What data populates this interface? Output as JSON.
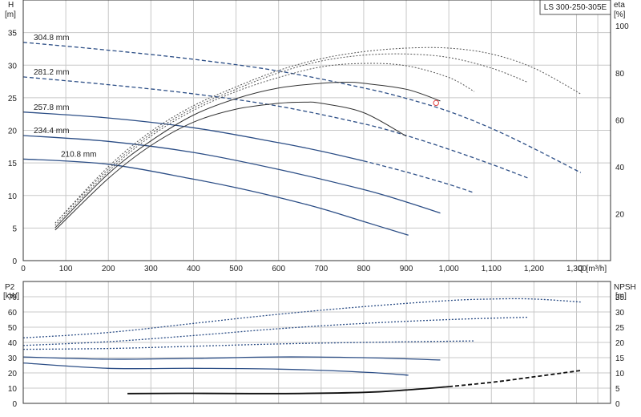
{
  "model_label": "LS 300-250-305E",
  "top_chart": {
    "y_label_name": "H",
    "y_label_unit": "[m]",
    "y2_label_name": "eta",
    "y2_label_unit": "[%]",
    "x_label": "Q [m³/h]",
    "x_ticks": [
      "0",
      "100",
      "200",
      "300",
      "400",
      "500",
      "600",
      "700",
      "800",
      "900",
      "1,000",
      "1,100",
      "1,200",
      "1,300"
    ],
    "y_ticks": [
      "0",
      "5",
      "10",
      "15",
      "20",
      "25",
      "30",
      "35"
    ],
    "y2_ticks": [
      "20",
      "40",
      "60",
      "80",
      "100"
    ]
  },
  "bottom_chart": {
    "y_label_name": "P2",
    "y_label_unit": "[kW]",
    "y2_label_name": "NPSH",
    "y2_label_unit": "[m]",
    "y_ticks": [
      "0",
      "10",
      "20",
      "30",
      "40",
      "50",
      "60",
      "70"
    ],
    "y2_ticks": [
      "0",
      "5",
      "10",
      "15",
      "20",
      "25",
      "30",
      "35"
    ]
  },
  "chart_data": [
    {
      "type": "line",
      "title": "",
      "xlabel": "Q [m³/h]",
      "ylabel": "H [m]",
      "y2label": "eta [%]",
      "xlim": [
        0,
        1380
      ],
      "ylim": [
        0,
        40
      ],
      "y2lim": [
        0,
        111
      ],
      "grid": true,
      "series": [
        {
          "name": "304.8 mm",
          "kind": "head",
          "style": "dashed",
          "color": "#2c4e86",
          "x": [
            0,
            200,
            400,
            600,
            800,
            900,
            1000,
            1100,
            1200,
            1310
          ],
          "y": [
            33.5,
            32.3,
            30.9,
            29.1,
            26.5,
            24.9,
            22.9,
            20.3,
            17.2,
            13.5
          ]
        },
        {
          "name": "281.2 mm",
          "kind": "head",
          "style": "dashed",
          "color": "#2c4e86",
          "x": [
            0,
            200,
            400,
            600,
            800,
            900,
            1000,
            1100,
            1185
          ],
          "y": [
            28.2,
            27.0,
            25.6,
            23.7,
            21.0,
            19.2,
            17.1,
            14.8,
            12.7
          ]
        },
        {
          "name": "257.8 mm",
          "kind": "head",
          "style": "solid-dashed",
          "color": "#2c4e86",
          "x": [
            0,
            200,
            400,
            600,
            700,
            800,
            900,
            1000,
            1060
          ],
          "y": [
            22.8,
            21.9,
            20.4,
            18.1,
            16.8,
            15.3,
            13.6,
            11.7,
            10.4
          ]
        },
        {
          "name": "234.4 mm",
          "kind": "head",
          "style": "solid",
          "color": "#2c4e86",
          "x": [
            0,
            200,
            400,
            600,
            800,
            900,
            980
          ],
          "y": [
            19.2,
            18.3,
            16.6,
            14.0,
            10.9,
            9.0,
            7.3
          ]
        },
        {
          "name": "210.8 mm",
          "kind": "head",
          "style": "solid",
          "color": "#2c4e86",
          "x": [
            0,
            200,
            400,
            500,
            600,
            700,
            800,
            905
          ],
          "y": [
            15.6,
            14.8,
            12.5,
            11.2,
            9.7,
            8.0,
            6.0,
            3.9
          ]
        },
        {
          "name": "eta 304.8 mm",
          "kind": "eta",
          "style": "dotted",
          "color": "#555555",
          "x": [
            75,
            200,
            300,
            400,
            500,
            600,
            700,
            800,
            900,
            1000,
            1100,
            1200,
            1310
          ],
          "y": [
            16,
            40,
            55,
            66,
            74,
            81,
            86,
            89,
            90.5,
            90.5,
            88,
            82,
            71
          ]
        },
        {
          "name": "eta 281.2 mm",
          "kind": "eta",
          "style": "dotted",
          "color": "#555555",
          "x": [
            75,
            200,
            300,
            400,
            500,
            600,
            700,
            800,
            900,
            1000,
            1100,
            1185
          ],
          "y": [
            16,
            39,
            54,
            65,
            73,
            80,
            85,
            87.5,
            88,
            86.5,
            82,
            76
          ]
        },
        {
          "name": "eta 257.8 mm",
          "kind": "eta",
          "style": "dotted",
          "color": "#555555",
          "x": [
            75,
            200,
            300,
            400,
            500,
            600,
            700,
            800,
            900,
            1000,
            1060
          ],
          "y": [
            15,
            38,
            53,
            64,
            72,
            78,
            82.5,
            84,
            83,
            78,
            72
          ]
        },
        {
          "name": "eta 234.4 mm",
          "kind": "eta",
          "style": "solid",
          "color": "#333333",
          "x": [
            75,
            200,
            300,
            400,
            500,
            600,
            700,
            760,
            800,
            900,
            980
          ],
          "y": [
            14,
            37,
            51,
            62,
            69,
            73.5,
            75.5,
            76,
            75.5,
            73,
            68
          ]
        },
        {
          "name": "eta 210.8 mm",
          "kind": "eta",
          "style": "solid",
          "color": "#333333",
          "x": [
            75,
            200,
            300,
            400,
            500,
            600,
            660,
            700,
            800,
            900
          ],
          "y": [
            13,
            35,
            49,
            59,
            64.5,
            67,
            67.5,
            67,
            63,
            53
          ]
        }
      ],
      "duty_point": {
        "x": 970,
        "y": 24.2,
        "color": "#e04040"
      }
    },
    {
      "type": "line",
      "title": "",
      "xlabel": "",
      "ylabel": "P2 [kW]",
      "y2label": "NPSH [m]",
      "xlim": [
        0,
        1380
      ],
      "ylim": [
        0,
        80
      ],
      "y2lim": [
        0,
        40
      ],
      "grid": true,
      "series": [
        {
          "name": "P2 304.8 mm",
          "kind": "power",
          "style": "dotted",
          "color": "#2c4e86",
          "x": [
            0,
            200,
            400,
            600,
            800,
            1000,
            1100,
            1200,
            1310
          ],
          "y": [
            43,
            46.5,
            52.5,
            58.5,
            63.5,
            67.5,
            68.5,
            68.5,
            66.5
          ]
        },
        {
          "name": "P2 281.2 mm",
          "kind": "power",
          "style": "dotted",
          "color": "#2c4e86",
          "x": [
            0,
            200,
            400,
            600,
            800,
            1000,
            1185
          ],
          "y": [
            38,
            40.5,
            44.5,
            49,
            52.5,
            55,
            56.5
          ]
        },
        {
          "name": "P2 257.8 mm",
          "kind": "power",
          "style": "dotted",
          "color": "#2c4e86",
          "x": [
            0,
            200,
            400,
            600,
            800,
            1060
          ],
          "y": [
            35.5,
            36,
            37.5,
            39,
            40,
            41
          ]
        },
        {
          "name": "P2 234.4 mm",
          "kind": "power",
          "style": "solid",
          "color": "#2c4e86",
          "x": [
            0,
            200,
            400,
            600,
            800,
            980
          ],
          "y": [
            30.5,
            29,
            29.5,
            30.5,
            30,
            28.5
          ]
        },
        {
          "name": "P2 210.8 mm",
          "kind": "power",
          "style": "solid",
          "color": "#2c4e86",
          "x": [
            0,
            200,
            400,
            600,
            800,
            905
          ],
          "y": [
            26.5,
            23,
            23,
            22.5,
            20.5,
            18.5
          ]
        },
        {
          "name": "NPSH",
          "kind": "npsh",
          "style": "solid-dashed",
          "color": "#111111",
          "axis": "right",
          "x": [
            245,
            400,
            600,
            800,
            900,
            1000,
            1100,
            1200,
            1310
          ],
          "y": [
            3.2,
            3.3,
            3.2,
            3.6,
            4.4,
            5.5,
            6.9,
            8.7,
            10.8
          ]
        }
      ]
    }
  ]
}
